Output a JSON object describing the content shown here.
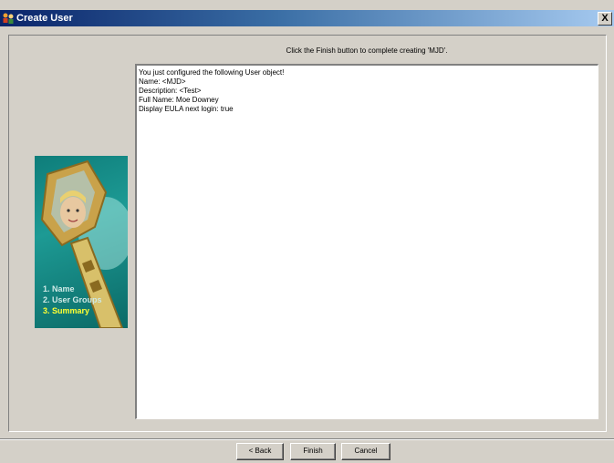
{
  "window": {
    "title": "Create User",
    "close_label": "X"
  },
  "instruction": "Click the Finish button to complete creating 'MJD'.",
  "summary": {
    "lines": [
      "You just configured the following User object!",
      "Name: <MJD>",
      "Description: <Test>",
      "Full Name: Moe Downey",
      "Display EULA next login: true"
    ]
  },
  "steps": [
    {
      "label": "1. Name",
      "current": false
    },
    {
      "label": "2. User Groups",
      "current": false
    },
    {
      "label": "3. Summary",
      "current": true
    }
  ],
  "buttons": {
    "back": "< Back",
    "finish": "Finish",
    "cancel": "Cancel"
  },
  "colors": {
    "title_bar": "#0a246a",
    "current_step": "#ffff33",
    "wizard_panel": "#0e7d7a"
  },
  "icons": {
    "title_icon": "users-icon",
    "wizard_art": "key-with-face-illustration"
  }
}
